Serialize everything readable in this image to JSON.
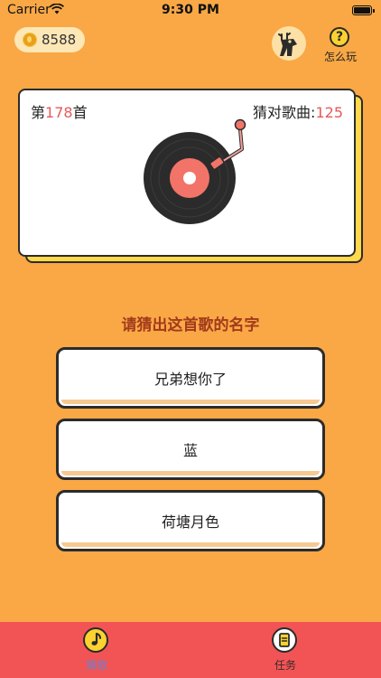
{
  "status_bar": {
    "carrier": "Carrier",
    "time": "9:30 PM"
  },
  "header": {
    "coins": "8588",
    "help_label": "怎么玩"
  },
  "song_card": {
    "count_prefix": "第",
    "count_value": "178",
    "count_suffix": "首",
    "guessed_label": "猜对歌曲:",
    "guessed_value": "125"
  },
  "question": "请猜出这首歌的名字",
  "options": [
    "兄弟想你了",
    "蓝",
    "荷塘月色"
  ],
  "tabs": [
    {
      "label": "猜歌",
      "icon": "music-note-icon",
      "active": true
    },
    {
      "label": "任务",
      "icon": "task-clipboard-icon",
      "active": false
    }
  ],
  "colors": {
    "background": "#F9A845",
    "accent_number": "#E55A5A",
    "question_text": "#A23A1C",
    "tab_bar": "#F25455",
    "card_shadow": "#FFD84C"
  }
}
